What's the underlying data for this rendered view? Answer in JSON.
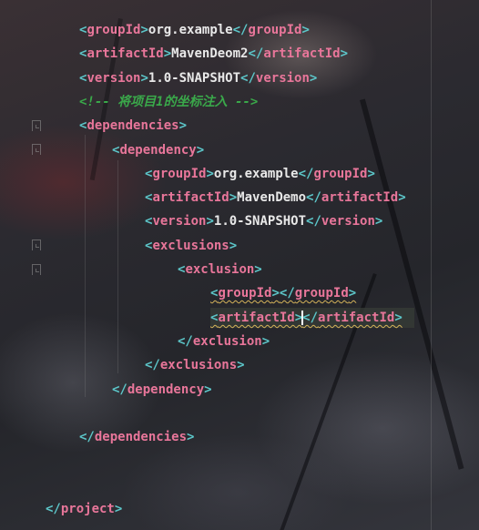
{
  "editor": {
    "lines": [
      {
        "indent": 0,
        "kind": "element",
        "tag": "groupId",
        "value": "org.example"
      },
      {
        "indent": 0,
        "kind": "element",
        "tag": "artifactId",
        "value": "MavenDeom2"
      },
      {
        "indent": 0,
        "kind": "element",
        "tag": "version",
        "value": "1.0-SNAPSHOT"
      },
      {
        "indent": 0,
        "kind": "comment",
        "text": "<!-- 将项目1的坐标注入 -->"
      },
      {
        "indent": 0,
        "kind": "open",
        "tag": "dependencies"
      },
      {
        "indent": 1,
        "kind": "open",
        "tag": "dependency"
      },
      {
        "indent": 2,
        "kind": "element",
        "tag": "groupId",
        "value": "org.example"
      },
      {
        "indent": 2,
        "kind": "element",
        "tag": "artifactId",
        "value": "MavenDemo"
      },
      {
        "indent": 2,
        "kind": "element",
        "tag": "version",
        "value": "1.0-SNAPSHOT"
      },
      {
        "indent": 2,
        "kind": "open",
        "tag": "exclusions"
      },
      {
        "indent": 3,
        "kind": "open",
        "tag": "exclusion"
      },
      {
        "indent": 4,
        "kind": "element",
        "tag": "groupId",
        "value": "",
        "warning": true
      },
      {
        "indent": 4,
        "kind": "element",
        "tag": "artifactId",
        "value": "",
        "warning": true,
        "caret": true,
        "current": true
      },
      {
        "indent": 3,
        "kind": "close",
        "tag": "exclusion"
      },
      {
        "indent": 2,
        "kind": "close",
        "tag": "exclusions"
      },
      {
        "indent": 1,
        "kind": "close",
        "tag": "dependency"
      },
      {
        "indent": 0,
        "kind": "blank"
      },
      {
        "indent": 0,
        "kind": "close",
        "tag": "dependencies"
      },
      {
        "indent": 0,
        "kind": "blank"
      },
      {
        "indent": 0,
        "kind": "blank"
      },
      {
        "indent": -1,
        "kind": "close",
        "tag": "project"
      }
    ]
  }
}
